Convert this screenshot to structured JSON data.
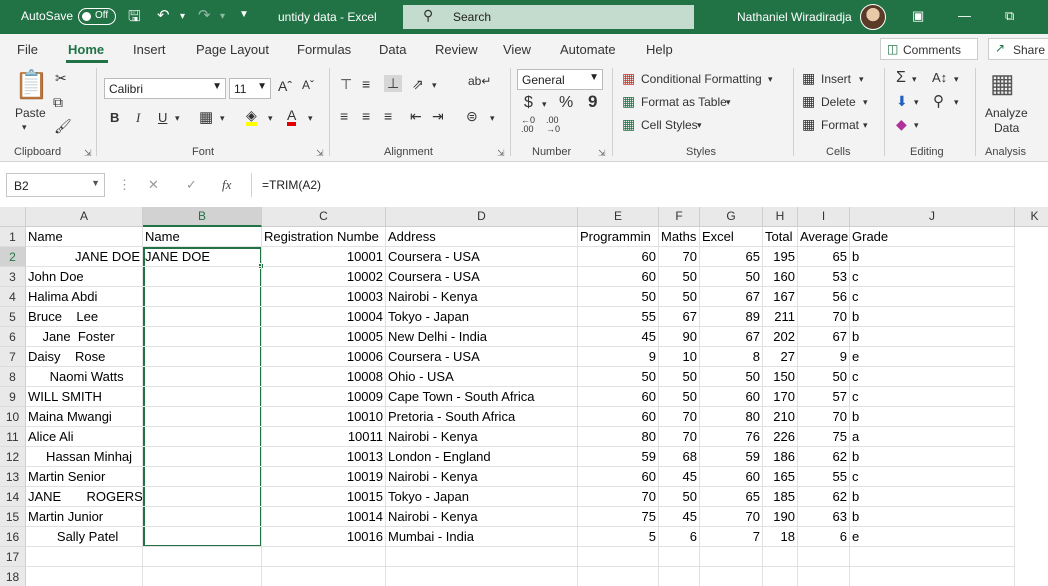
{
  "titlebar": {
    "autosave_label": "AutoSave",
    "autosave_state": "Off",
    "doc_title": "untidy data  -  Excel",
    "search_placeholder": "Search",
    "user_name": "Nathaniel Wiradiradja"
  },
  "tabs": [
    "File",
    "Home",
    "Insert",
    "Page Layout",
    "Formulas",
    "Data",
    "Review",
    "View",
    "Automate",
    "Help"
  ],
  "active_tab": "Home",
  "actions": {
    "comments": "Comments",
    "share": "Share"
  },
  "ribbon": {
    "clipboard": {
      "label": "Clipboard",
      "paste": "Paste"
    },
    "font": {
      "label": "Font",
      "name": "Calibri",
      "size": "11",
      "bold": "B",
      "italic": "I",
      "underline": "U"
    },
    "alignment": {
      "label": "Alignment"
    },
    "number": {
      "label": "Number",
      "format": "General",
      "currency": "$",
      "percent": "%",
      "comma": "9"
    },
    "styles": {
      "label": "Styles",
      "conditional": "Conditional Formatting",
      "table": "Format as Table",
      "cell_styles": "Cell Styles"
    },
    "cells": {
      "label": "Cells",
      "insert": "Insert",
      "delete": "Delete",
      "format": "Format"
    },
    "editing": {
      "label": "Editing"
    },
    "analysis": {
      "label": "Analysis",
      "analyze1": "Analyze",
      "analyze2": "Data"
    }
  },
  "formula_bar": {
    "name_box": "B2",
    "formula": "=TRIM(A2)"
  },
  "sheet": {
    "columns": [
      "A",
      "B",
      "C",
      "D",
      "E",
      "F",
      "G",
      "H",
      "I",
      "J",
      "K"
    ],
    "selected_column": "B",
    "selected_row": "2",
    "rows": [
      {
        "n": "1",
        "a": "Name",
        "b": "Name",
        "c": "Registration Numbe",
        "d": "Address",
        "e": "Programmin",
        "f": "Maths",
        "g": "Excel",
        "h": "Total",
        "i": "Average",
        "j": "Grade"
      },
      {
        "n": "2",
        "a": "          JANE DOE",
        "b": "JANE DOE",
        "c": "10001",
        "d": "Coursera - USA",
        "e": "60",
        "f": "70",
        "g": "65",
        "h": "195",
        "i": "65",
        "j": "b"
      },
      {
        "n": "3",
        "a": "John Doe",
        "b": "",
        "c": "10002",
        "d": "Coursera - USA",
        "e": "60",
        "f": "50",
        "g": "50",
        "h": "160",
        "i": "53",
        "j": "c"
      },
      {
        "n": "4",
        "a": "Halima Abdi",
        "b": "",
        "c": "10003",
        "d": "Nairobi - Kenya",
        "e": "50",
        "f": "50",
        "g": "67",
        "h": "167",
        "i": "56",
        "j": "c"
      },
      {
        "n": "5",
        "a": "Bruce    Lee",
        "b": "",
        "c": "10004",
        "d": "Tokyo - Japan",
        "e": "55",
        "f": "67",
        "g": "89",
        "h": "211",
        "i": "70",
        "j": "b"
      },
      {
        "n": "6",
        "a": "    Jane  Foster",
        "b": "",
        "c": "10005",
        "d": "New Delhi - India",
        "e": "45",
        "f": "90",
        "g": "67",
        "h": "202",
        "i": "67",
        "j": "b"
      },
      {
        "n": "7",
        "a": "Daisy    Rose",
        "b": "",
        "c": "10006",
        "d": "Coursera - USA",
        "e": "9",
        "f": "10",
        "g": "8",
        "h": "27",
        "i": "9",
        "j": "e"
      },
      {
        "n": "8",
        "a": "      Naomi Watts",
        "b": "",
        "c": "10008",
        "d": "Ohio - USA",
        "e": "50",
        "f": "50",
        "g": "50",
        "h": "150",
        "i": "50",
        "j": "c"
      },
      {
        "n": "9",
        "a": "WILL SMITH",
        "b": "",
        "c": "10009",
        "d": "Cape Town - South Africa",
        "e": "60",
        "f": "50",
        "g": "60",
        "h": "170",
        "i": "57",
        "j": "c"
      },
      {
        "n": "10",
        "a": "Maina Mwangi",
        "b": "",
        "c": "10010",
        "d": "Pretoria - South Africa",
        "e": "60",
        "f": "70",
        "g": "80",
        "h": "210",
        "i": "70",
        "j": "b"
      },
      {
        "n": "11",
        "a": "Alice Ali",
        "b": "",
        "c": "10011",
        "d": "Nairobi - Kenya",
        "e": "80",
        "f": "70",
        "g": "76",
        "h": "226",
        "i": "75",
        "j": "a"
      },
      {
        "n": "12",
        "a": "     Hassan Minhaj",
        "b": "",
        "c": "10013",
        "d": "London - England",
        "e": "59",
        "f": "68",
        "g": "59",
        "h": "186",
        "i": "62",
        "j": "b"
      },
      {
        "n": "13",
        "a": "Martin Senior",
        "b": "",
        "c": "10019",
        "d": "Nairobi - Kenya",
        "e": "60",
        "f": "45",
        "g": "60",
        "h": "165",
        "i": "55",
        "j": "c"
      },
      {
        "n": "14",
        "a": "JANE       ROGERS",
        "b": "",
        "c": "10015",
        "d": "Tokyo - Japan",
        "e": "70",
        "f": "50",
        "g": "65",
        "h": "185",
        "i": "62",
        "j": "b"
      },
      {
        "n": "15",
        "a": "Martin Junior",
        "b": "",
        "c": "10014",
        "d": "Nairobi - Kenya",
        "e": "75",
        "f": "45",
        "g": "70",
        "h": "190",
        "i": "63",
        "j": "b"
      },
      {
        "n": "16",
        "a": "        Sally Patel",
        "b": "",
        "c": "10016",
        "d": "Mumbai - India",
        "e": "5",
        "f": "6",
        "g": "7",
        "h": "18",
        "i": "6",
        "j": "e"
      },
      {
        "n": "17",
        "a": "",
        "b": "",
        "c": "",
        "d": "",
        "e": "",
        "f": "",
        "g": "",
        "h": "",
        "i": "",
        "j": ""
      },
      {
        "n": "18",
        "a": "",
        "b": "",
        "c": "",
        "d": "",
        "e": "",
        "f": "",
        "g": "",
        "h": "",
        "i": "",
        "j": ""
      }
    ]
  },
  "colors": {
    "excel_green": "#217346",
    "search_bg": "#c3dccd"
  }
}
